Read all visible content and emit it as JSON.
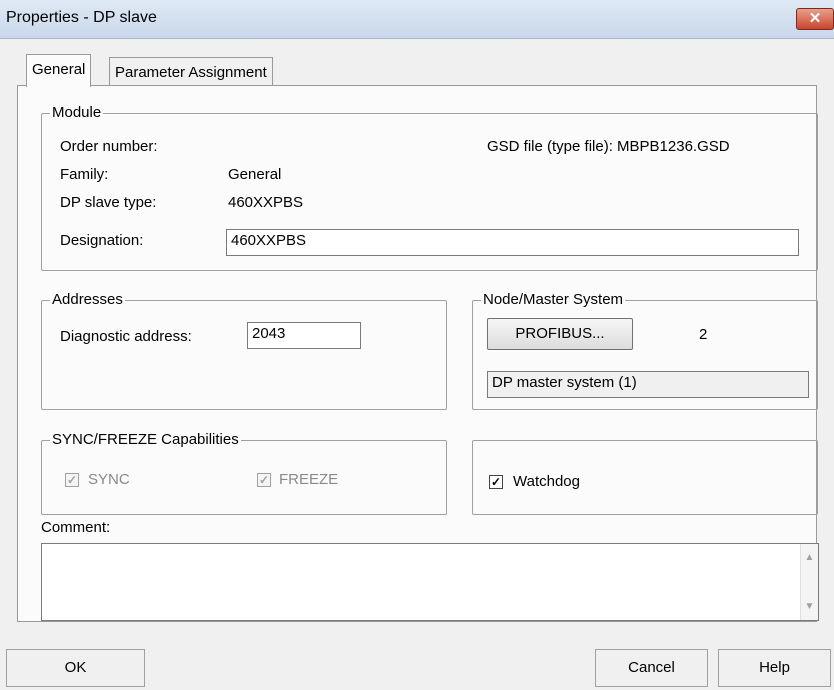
{
  "window": {
    "title": "Properties - DP slave",
    "close_glyph": "✕"
  },
  "tabs": [
    {
      "label": "General"
    },
    {
      "label": "Parameter Assignment"
    }
  ],
  "module": {
    "legend": "Module",
    "order_number_label": "Order number:",
    "gsd_label": "GSD file (type file): MBPB1236.GSD",
    "family_label": "Family:",
    "family_value": "General",
    "slave_type_label": "DP slave type:",
    "slave_type_value": "460XXPBS",
    "designation_label": "Designation:",
    "designation_value": "460XXPBS"
  },
  "addresses": {
    "legend": "Addresses",
    "diag_label": "Diagnostic address:",
    "diag_value": "2043"
  },
  "node": {
    "legend": "Node/Master System",
    "profibus_button": "PROFIBUS...",
    "address": "2",
    "master_system": "DP master system (1)"
  },
  "sync": {
    "legend": "SYNC/FREEZE Capabilities",
    "sync_label": "SYNC",
    "sync_checked": true,
    "freeze_label": "FREEZE",
    "freeze_checked": true
  },
  "watchdog": {
    "label": "Watchdog",
    "checked": true
  },
  "comment": {
    "label": "Comment:",
    "value": ""
  },
  "footer": {
    "ok": "OK",
    "cancel": "Cancel",
    "help": "Help"
  },
  "icons": {
    "check": "✓",
    "scroll_up": "▲",
    "scroll_down": "▼"
  }
}
